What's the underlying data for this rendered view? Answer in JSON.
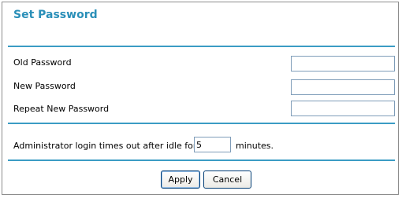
{
  "page": {
    "title": "Set Password"
  },
  "fields": {
    "old_password": {
      "label": "Old Password",
      "value": ""
    },
    "new_password": {
      "label": "New Password",
      "value": ""
    },
    "repeat_password": {
      "label": "Repeat New Password",
      "value": ""
    }
  },
  "idle": {
    "prefix": "Administrator login times out after idle for",
    "value": "5",
    "suffix": "minutes."
  },
  "buttons": {
    "apply": "Apply",
    "cancel": "Cancel"
  },
  "colors": {
    "accent": "#2a8fb8",
    "rule": "#3b9cc4"
  }
}
